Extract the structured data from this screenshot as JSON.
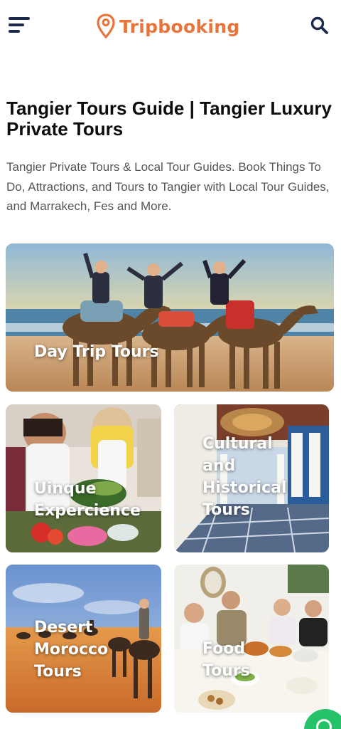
{
  "header": {
    "brand_name": "Tripbooking",
    "menu_icon": "hamburger-menu-icon",
    "search_icon": "search-icon",
    "logo_icon": "map-pin-logo-icon",
    "brand_color": "#e8743b",
    "icon_color": "#1b2a4a"
  },
  "page": {
    "title": "Tangier Tours Guide | Tangier Luxury Private Tours",
    "description": "Tangier Private Tours & Local Tour Guides. Book Things To Do, Attractions, and Tours to Tangier with Local Tour Guides, and Marrakech, Fes and More."
  },
  "categories": [
    {
      "label": "Day Trip Tours"
    },
    {
      "label": "Uinque Expercience"
    },
    {
      "label": "Cultural and Historical Tours"
    },
    {
      "label": "Desert Morocco Tours"
    },
    {
      "label": "Food Tours"
    }
  ],
  "chat": {
    "icon": "whatsapp-chat-icon",
    "color": "#25c26a"
  }
}
